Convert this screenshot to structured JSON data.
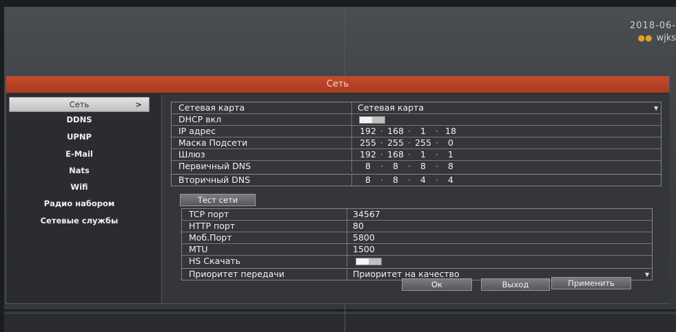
{
  "status": {
    "datetime": "2018-06-",
    "user": "wjks"
  },
  "dialog": {
    "title": "Сеть"
  },
  "sidebar": {
    "items": [
      {
        "label": "Сеть",
        "arrow": ">"
      },
      {
        "label": "DDNS"
      },
      {
        "label": "UPNP"
      },
      {
        "label": "E-Mail"
      },
      {
        "label": "Nats"
      },
      {
        "label": "Wifi"
      },
      {
        "label": "Радио набором"
      },
      {
        "label": "Сетевые службы"
      }
    ]
  },
  "network": {
    "card": {
      "label": "Сетевая карта",
      "value": "Сетевая карта"
    },
    "dhcp": {
      "label": "DHCP вкл",
      "enabled": false
    },
    "ip": {
      "label": "IP адрес",
      "octets": [
        "192",
        "168",
        "1",
        "18"
      ]
    },
    "mask": {
      "label": "Маска Подсети",
      "octets": [
        "255",
        "255",
        "255",
        "0"
      ]
    },
    "gateway": {
      "label": "Шлюз",
      "octets": [
        "192",
        "168",
        "1",
        "1"
      ]
    },
    "dns1": {
      "label": "Первичный DNS",
      "octets": [
        "8",
        "8",
        "8",
        "8"
      ]
    },
    "dns2": {
      "label": "Вторичный DNS",
      "octets": [
        "8",
        "8",
        "4",
        "4"
      ]
    }
  },
  "test_button": "Тест сети",
  "ports": {
    "tcp": {
      "label": "TCP порт",
      "value": "34567"
    },
    "http": {
      "label": "HTTP порт",
      "value": "80"
    },
    "mobile": {
      "label": "Моб.Порт",
      "value": "5800"
    },
    "mtu": {
      "label": "MTU",
      "value": "1500"
    },
    "hs": {
      "label": "HS Скачать",
      "enabled": false
    },
    "priority": {
      "label": "Приоритет передачи",
      "value": "Приоритет на качество"
    }
  },
  "buttons": {
    "ok": "Ок",
    "exit": "Выход",
    "apply": "Применить"
  }
}
